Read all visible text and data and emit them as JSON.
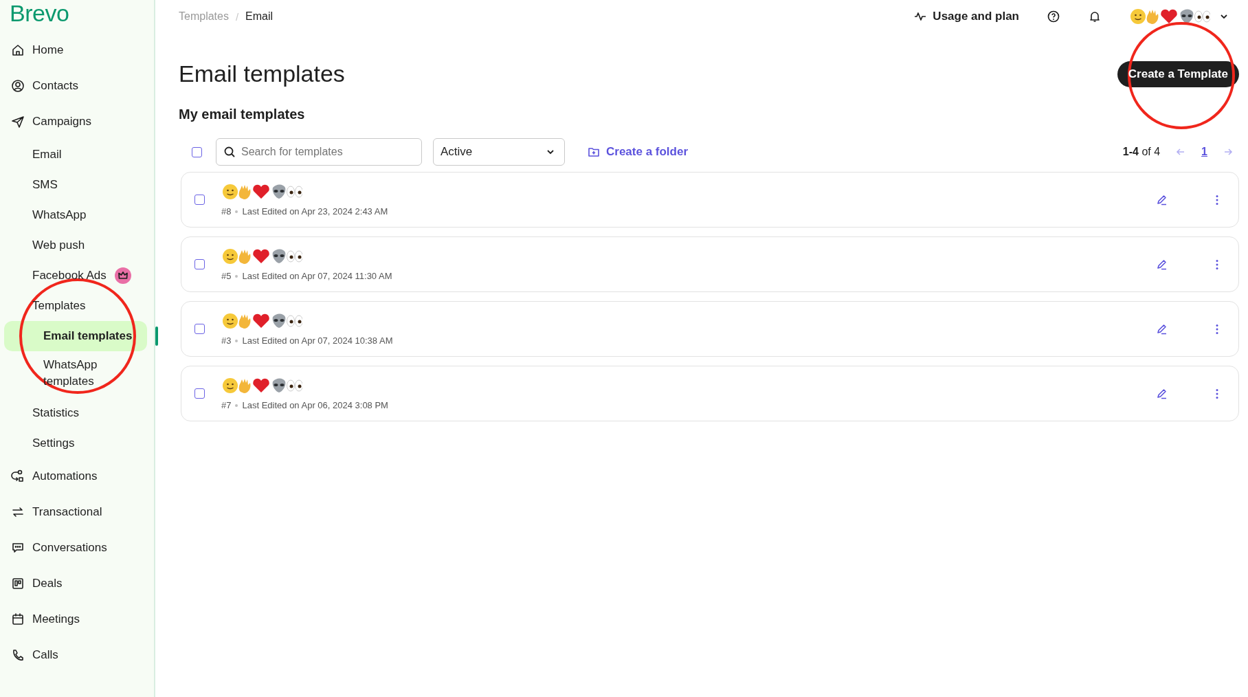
{
  "sidebar": {
    "logo": "Brevo",
    "items": [
      {
        "label": "Home",
        "selected": false
      },
      {
        "label": "Contacts",
        "selected": false
      },
      {
        "label": "Campaigns",
        "selected": false,
        "children": [
          {
            "label": "Email",
            "selected": false,
            "premium": false
          },
          {
            "label": "SMS",
            "selected": false,
            "premium": false
          },
          {
            "label": "WhatsApp",
            "selected": false,
            "premium": false
          },
          {
            "label": "Web push",
            "selected": false,
            "premium": false
          },
          {
            "label": "Facebook Ads",
            "selected": false,
            "premium": true
          },
          {
            "label": "Templates",
            "selected": false,
            "premium": false,
            "children": [
              {
                "label": "Email templates",
                "selected": true
              },
              {
                "label": "WhatsApp templates",
                "selected": false
              }
            ]
          },
          {
            "label": "Statistics",
            "selected": false,
            "premium": false
          },
          {
            "label": "Settings",
            "selected": false,
            "premium": false
          }
        ]
      },
      {
        "label": "Automations",
        "selected": false
      },
      {
        "label": "Transactional",
        "selected": false
      },
      {
        "label": "Conversations",
        "selected": false
      },
      {
        "label": "Deals",
        "selected": false
      },
      {
        "label": "Meetings",
        "selected": false
      },
      {
        "label": "Calls",
        "selected": false
      }
    ]
  },
  "breadcrumbs": [
    "Templates",
    "Email"
  ],
  "breadcrumb_separator": "/",
  "top_bar": {
    "usage": "Usage and plan"
  },
  "page_title": "Email templates",
  "create_button": "Create a Template",
  "section_title": "My email templates",
  "toolbar": {
    "select_all_checked": false,
    "search": {
      "placeholder": "Search for templates"
    },
    "status_filter": "Active",
    "create_folder": "Create a folder",
    "range": "**1-4** of 4",
    "page": "1"
  },
  "templates": [
    {
      "checked": false,
      "number": "#8",
      "edited": "Last Edited on Apr 23, 2024 2:43 AM"
    },
    {
      "checked": false,
      "number": "#5",
      "edited": "Last Edited on Apr 07, 2024 11:30 AM"
    },
    {
      "checked": false,
      "number": "#3",
      "edited": "Last Edited on Apr 07, 2024 10:38 AM"
    },
    {
      "checked": false,
      "number": "#7",
      "edited": "Last Edited on Apr 06, 2024 3:08 PM"
    }
  ]
}
